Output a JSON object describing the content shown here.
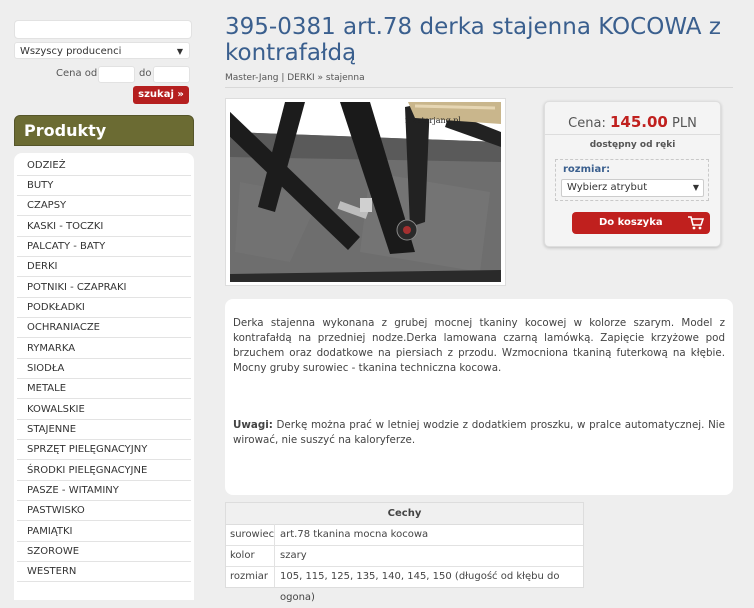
{
  "filters": {
    "search_placeholder": "",
    "producer_selected": "Wszyscy producenci",
    "price_from_label": "Cena od",
    "price_to_label": "do",
    "search_button": "szukaj »"
  },
  "sidebar": {
    "header": "Produkty",
    "items": [
      {
        "label": "ODZIEŻ"
      },
      {
        "label": "BUTY"
      },
      {
        "label": "CZAPSY"
      },
      {
        "label": "KASKI - TOCZKI"
      },
      {
        "label": "PALCATY - BATY"
      },
      {
        "label": "DERKI"
      },
      {
        "label": "POTNIKI - CZAPRAKI"
      },
      {
        "label": "PODKŁADKI"
      },
      {
        "label": "OCHRANIACZE"
      },
      {
        "label": "RYMARKA"
      },
      {
        "label": "SIODŁA"
      },
      {
        "label": "METALE"
      },
      {
        "label": "KOWALSKIE"
      },
      {
        "label": "STAJENNE"
      },
      {
        "label": "SPRZĘT PIELĘGNACYJNY"
      },
      {
        "label": "ŚRODKI PIELĘGNACYJNE"
      },
      {
        "label": "PASZE - WITAMINY"
      },
      {
        "label": "PASTWISKO"
      },
      {
        "label": "PAMIĄTKI"
      },
      {
        "label": "SZOROWE"
      },
      {
        "label": "WESTERN"
      }
    ]
  },
  "product": {
    "title": "395-0381 art.78 derka stajenna KOCOWA z kontrafałdą",
    "breadcrumb": "Master-Jang | DERKI » stajenna",
    "photo_watermark": "masterjang.pl"
  },
  "buy": {
    "price_label": "Cena:",
    "price_value": "145.00",
    "currency": "PLN",
    "availability": "dostępny od ręki",
    "attr_label": "rozmiar:",
    "attr_selected": "Wybierz atrybut",
    "cart_button": "Do koszyka"
  },
  "description": {
    "paragraph1": "Derka stajenna wykonana z grubej mocnej tkaniny kocowej w kolorze szarym. Model z kontrafałdą na przedniej nodze.Derka lamowana czarną lamówką. Zapięcie krzyżowe pod brzuchem oraz dodatkowe na piersiach z przodu. Wzmocniona tkaniną futerkową na kłębie. Mocny gruby surowiec - tkanina techniczna kocowa.",
    "warning_label": "Uwagi:",
    "warning_text": " Derkę można prać w letniej wodzie z dodatkiem proszku, w pralce automatycznej. Nie wirować, nie suszyć na kaloryferze."
  },
  "features": {
    "header": "Cechy",
    "rows": [
      {
        "key": "surowiec",
        "value": "art.78 tkanina mocna kocowa"
      },
      {
        "key": "kolor",
        "value": "szary"
      },
      {
        "key": "rozmiar",
        "value": "105, 115, 125, 135, 140, 145, 150 (długość od kłębu do ogona)"
      }
    ]
  },
  "colors": {
    "accent_red": "#c0201e",
    "title_blue": "#3a5f8e",
    "olive": "#6b6b33"
  }
}
